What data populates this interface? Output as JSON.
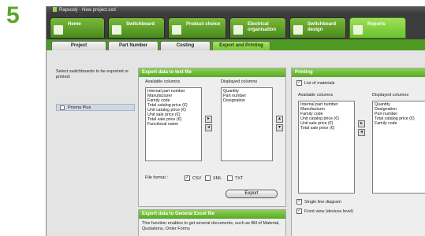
{
  "step_number": "5",
  "window": {
    "title": "Rapsody - New project.sxd"
  },
  "nav_tabs": [
    {
      "label": "Home",
      "icon": "home-icon"
    },
    {
      "label": "Switchboard",
      "icon": "switchboard-icon"
    },
    {
      "label": "Product choice",
      "icon": "product-choice-icon"
    },
    {
      "label": "Electrical organisation",
      "icon": "electrical-organisation-icon"
    },
    {
      "label": "Switchboard design",
      "icon": "switchboard-design-icon"
    },
    {
      "label": "Reports",
      "icon": "reports-icon"
    }
  ],
  "sub_tabs": [
    "Project",
    "Part Number",
    "Costing",
    "Export and Printing"
  ],
  "left_pane": {
    "title": "Select switchboards to be exported or printed:",
    "items": [
      "Prisma Plus"
    ]
  },
  "export_text": {
    "header": "Export data to text file",
    "available_label": "Available columns",
    "displayed_label": "Displayed columns",
    "available": [
      "Internal part number",
      "Manufacturer",
      "Family code",
      "Total catalog price (€)",
      "Unit catalog price (€)",
      "Unit sale price (€)",
      "Total sale price (€)",
      "Functional name"
    ],
    "displayed": [
      "Quantity",
      "Part number",
      "Designation"
    ],
    "format_label": "File format :",
    "formats": [
      {
        "label": "CSV",
        "checked": true
      },
      {
        "label": "XML",
        "checked": false
      },
      {
        "label": "TXT",
        "checked": false
      }
    ],
    "export_button": "Export"
  },
  "export_excel": {
    "header": "Export data to General Excel file",
    "description": "This function enables to get several documents, such as Bill of Material, Quotations, Order Forms"
  },
  "printing": {
    "header": "Printing",
    "list_of_materials": "List of materials",
    "available_label": "Available columns",
    "displayed_label": "Displayed columns",
    "available": [
      "Internal part number",
      "Manufacturer",
      "Family code",
      "Unit catalog price (€)",
      "Unit sale price (€)",
      "Total sale price (€)"
    ],
    "displayed": [
      "Quantity",
      "Designation",
      "Part number",
      "Total catalog price (€)",
      "Family code"
    ],
    "single_line": "Single line diagram",
    "front_view": "Front view (devices level)"
  },
  "arrows": {
    "right": "▸",
    "left": "◂",
    "up": "▴",
    "down": "▾"
  },
  "colors": {
    "accent": "#6cc22d",
    "nav": "#3c3c3c",
    "step": "#5aa52a"
  }
}
